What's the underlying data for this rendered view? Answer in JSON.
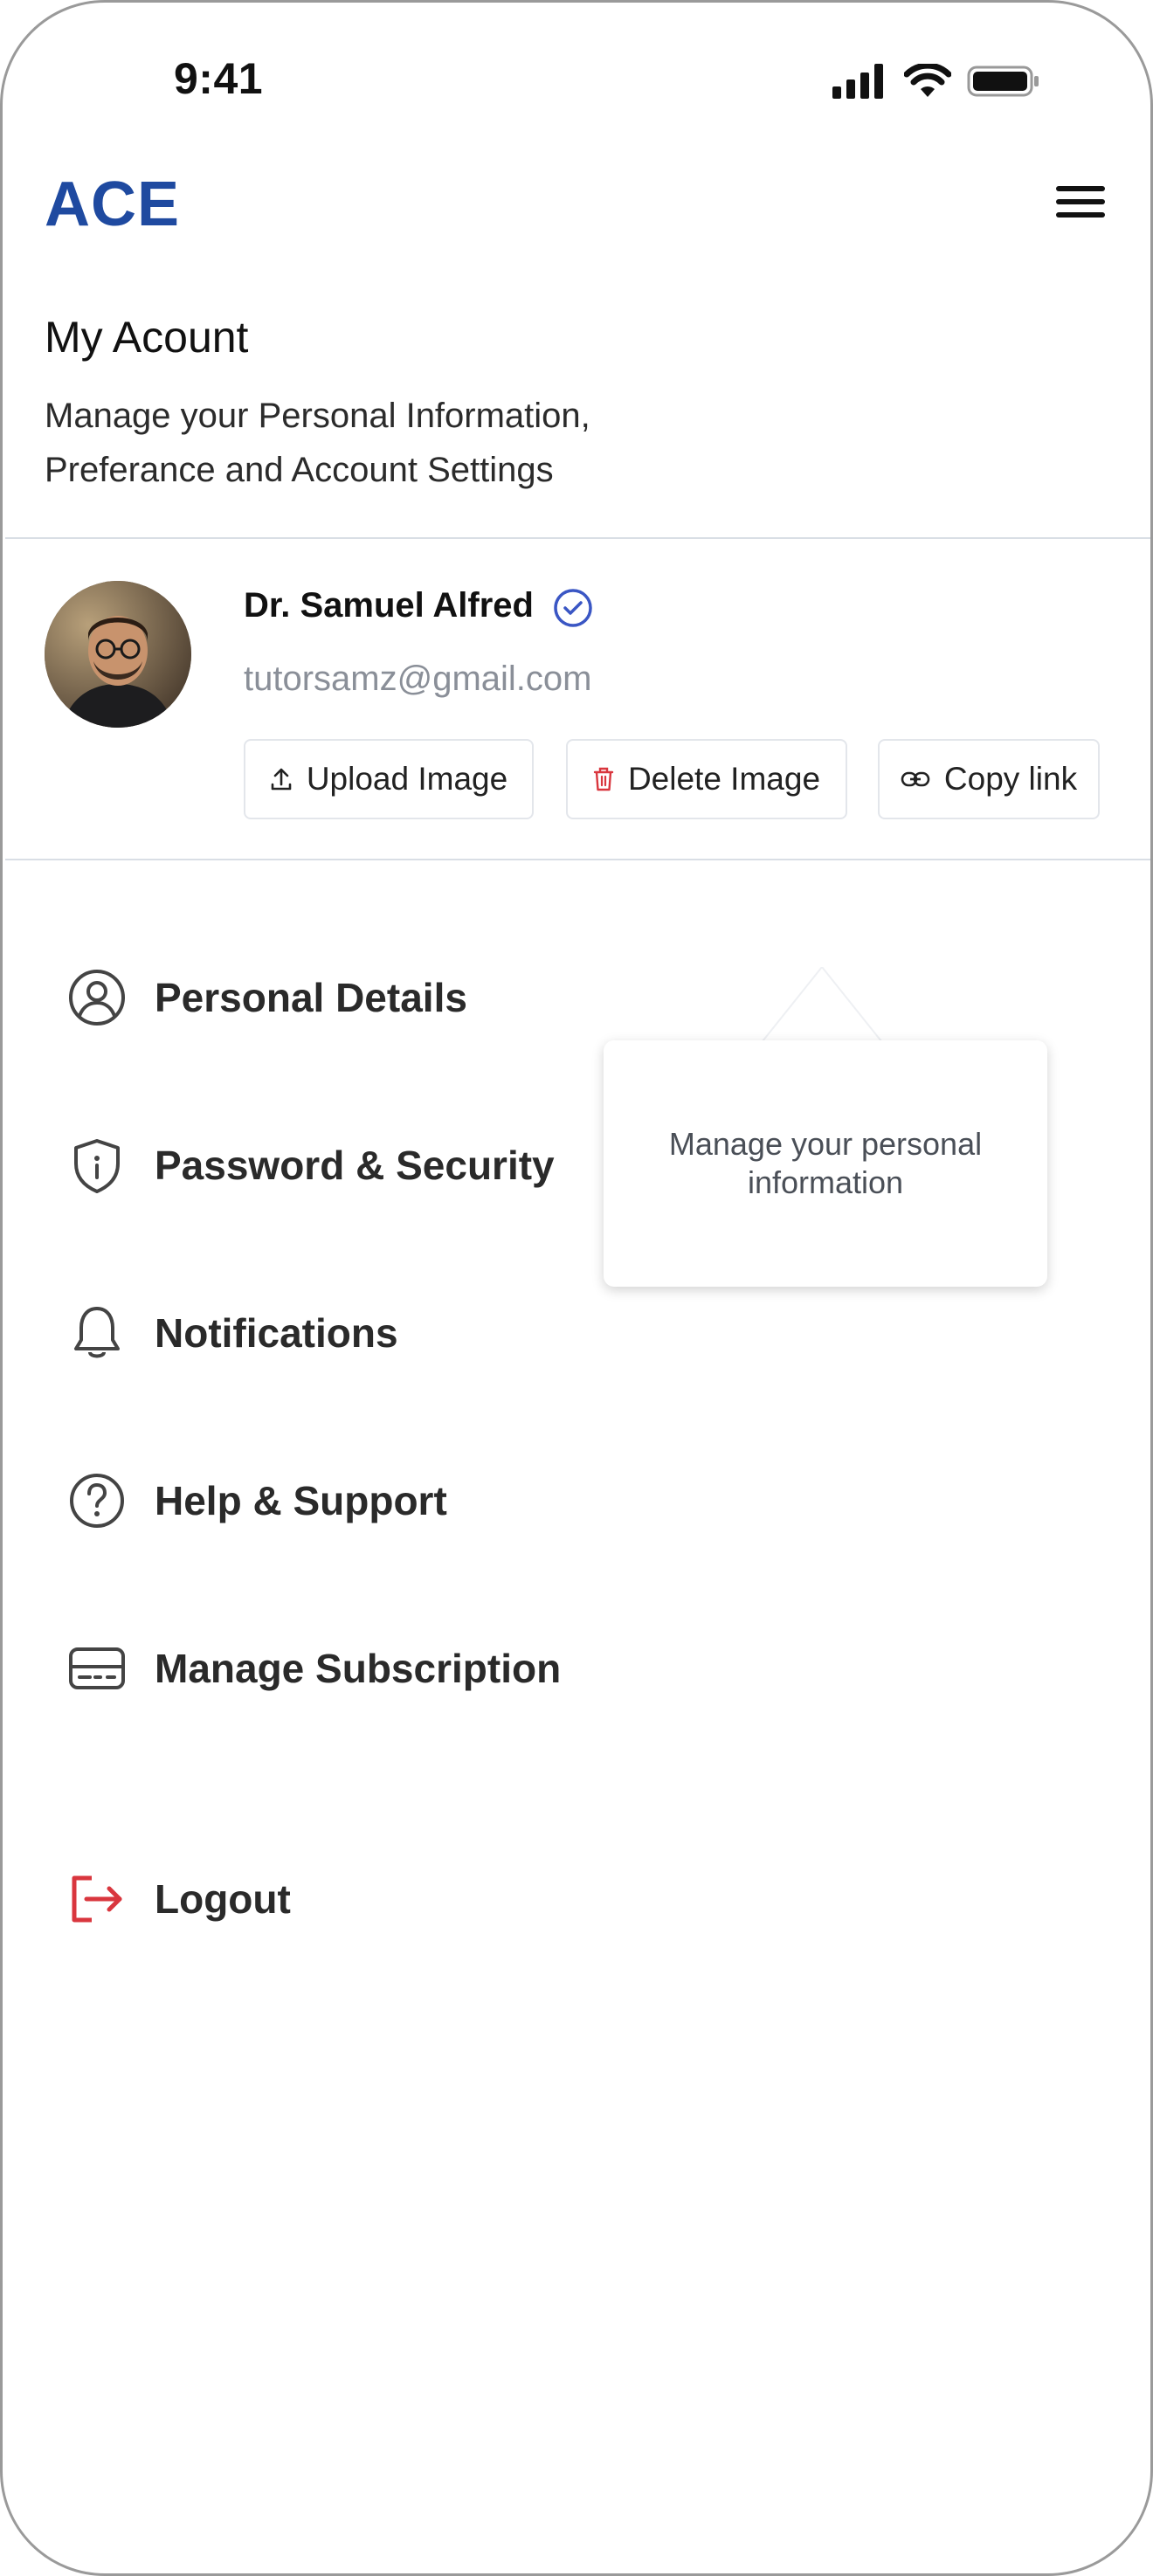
{
  "status_bar": {
    "time": "9:41"
  },
  "header": {
    "logo": "ACE",
    "menu_icon": "hamburger-menu-icon"
  },
  "account": {
    "title": "My Acount",
    "subtitle": "Manage your Personal Information, Preferance and Account Settings"
  },
  "profile": {
    "name": "Dr. Samuel Alfred",
    "email": "tutorsamz@gmail.com",
    "verified_icon": "check-circle-icon",
    "actions": [
      {
        "label": "Upload Image",
        "icon": "upload-icon"
      },
      {
        "label": "Delete Image",
        "icon": "trash-icon"
      },
      {
        "label": "Copy link",
        "icon": "link-icon"
      }
    ]
  },
  "menu": [
    {
      "label": "Personal Details",
      "icon": "user-circle-icon"
    },
    {
      "label": "Password & Security",
      "icon": "shield-icon"
    },
    {
      "label": "Notifications",
      "icon": "bell-icon"
    },
    {
      "label": "Help & Support",
      "icon": "help-circle-icon"
    },
    {
      "label": "Manage Subscription",
      "icon": "card-icon"
    }
  ],
  "logout": {
    "label": "Logout",
    "icon": "logout-icon"
  },
  "tooltip": {
    "text": "Manage your personal information"
  },
  "colors": {
    "brand": "#1f4aa0",
    "verified": "#3a56c4",
    "danger": "#d9363e",
    "muted": "#8a8f98"
  }
}
